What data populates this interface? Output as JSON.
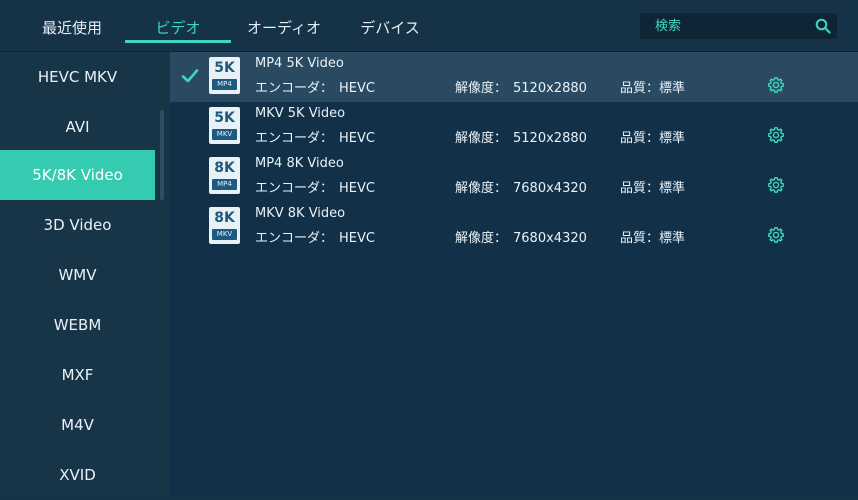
{
  "tabs": [
    {
      "label": "最近使用",
      "active": false
    },
    {
      "label": "ビデオ",
      "active": true
    },
    {
      "label": "オーディオ",
      "active": false
    },
    {
      "label": "デバイス",
      "active": false
    }
  ],
  "search": {
    "placeholder": "検索"
  },
  "sidebar": {
    "items": [
      {
        "label": "HEVC MKV"
      },
      {
        "label": "AVI"
      },
      {
        "label": "5K/8K Video",
        "active": true
      },
      {
        "label": "3D Video"
      },
      {
        "label": "WMV"
      },
      {
        "label": "WEBM"
      },
      {
        "label": "MXF"
      },
      {
        "label": "M4V"
      },
      {
        "label": "XVID"
      }
    ]
  },
  "formats": [
    {
      "title": "MP4 5K Video",
      "icon_big": "5K",
      "icon_small": "MP4",
      "encoder_label": "エンコーダ：",
      "encoder": "HEVC",
      "res_label": "解像度：",
      "resolution": "5120x2880",
      "quality_label": "品質：",
      "quality": "標準",
      "selected": true
    },
    {
      "title": "MKV 5K Video",
      "icon_big": "5K",
      "icon_small": "MKV",
      "encoder_label": "エンコーダ：",
      "encoder": "HEVC",
      "res_label": "解像度：",
      "resolution": "5120x2880",
      "quality_label": "品質：",
      "quality": "標準",
      "selected": false
    },
    {
      "title": "MP4 8K Video",
      "icon_big": "8K",
      "icon_small": "MP4",
      "encoder_label": "エンコーダ：",
      "encoder": "HEVC",
      "res_label": "解像度：",
      "resolution": "7680x4320",
      "quality_label": "品質：",
      "quality": "標準",
      "selected": false
    },
    {
      "title": "MKV 8K Video",
      "icon_big": "8K",
      "icon_small": "MKV",
      "encoder_label": "エンコーダ：",
      "encoder": "HEVC",
      "res_label": "解像度：",
      "resolution": "7680x4320",
      "quality_label": "品質：",
      "quality": "標準",
      "selected": false
    }
  ],
  "colors": {
    "accent": "#3fd6be",
    "sidebar_active": "#35cbb1",
    "background": "#163247",
    "selected_row": "#2a4a62"
  },
  "icons": {
    "search": "search-icon",
    "check": "check-icon",
    "settings": "gear-icon"
  }
}
